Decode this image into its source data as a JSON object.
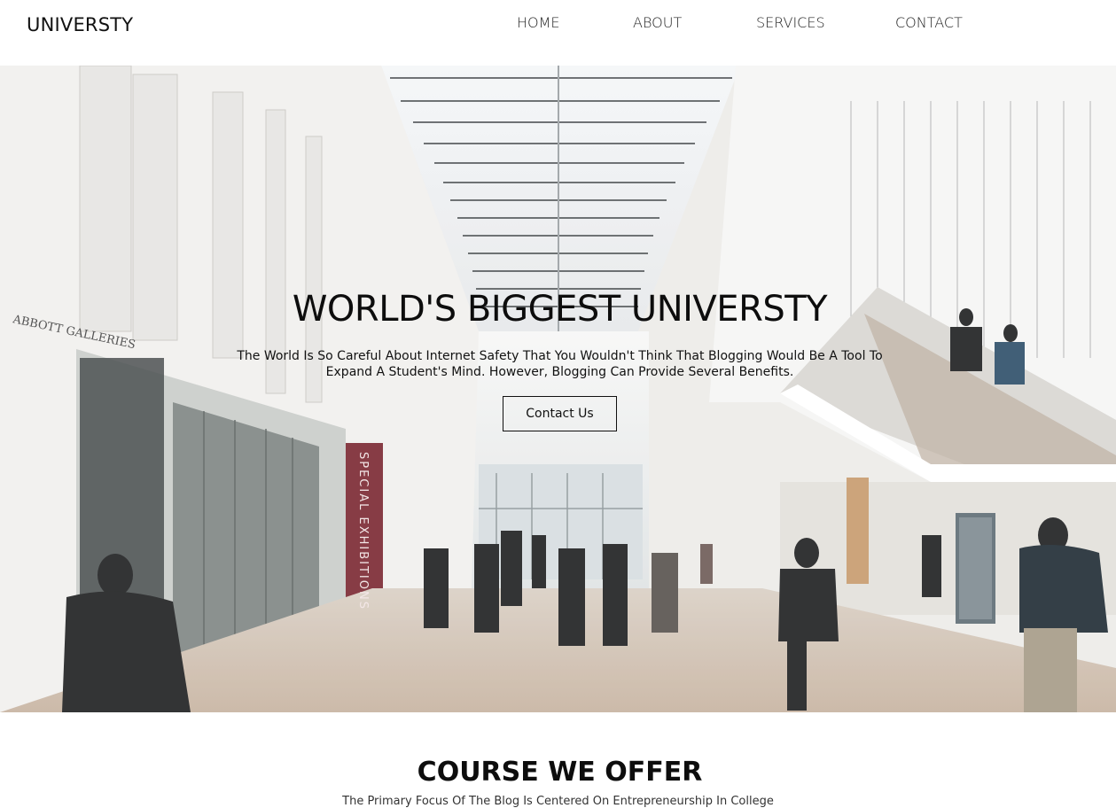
{
  "brand": {
    "logo_text": "UNIVERSTY"
  },
  "nav": {
    "items": [
      {
        "label": "HOME"
      },
      {
        "label": "ABOUT"
      },
      {
        "label": "SERVICES"
      },
      {
        "label": "CONTACT"
      }
    ]
  },
  "hero": {
    "title": "WORLD'S BIGGEST UNIVERSTY",
    "subtitle": "The World Is So Careful About Internet Safety That You Wouldn't Think That Blogging Would Be A Tool To Expand A Student's Mind. However, Blogging Can Provide Several Benefits.",
    "cta_label": "Contact Us",
    "photo_signs": {
      "gallery_sign": "ABBOTT GALLERIES",
      "exhibition_sign": "SPECIAL EXHIBITIONS"
    }
  },
  "courses": {
    "title": "COURSE WE OFFER",
    "subtitle": "The Primary Focus Of The Blog Is Centered On Entrepreneurship In College"
  },
  "colors": {
    "page_background": "#ffffff",
    "text_primary": "#0d0d0d",
    "exhibition_banner": "#7a2630"
  }
}
